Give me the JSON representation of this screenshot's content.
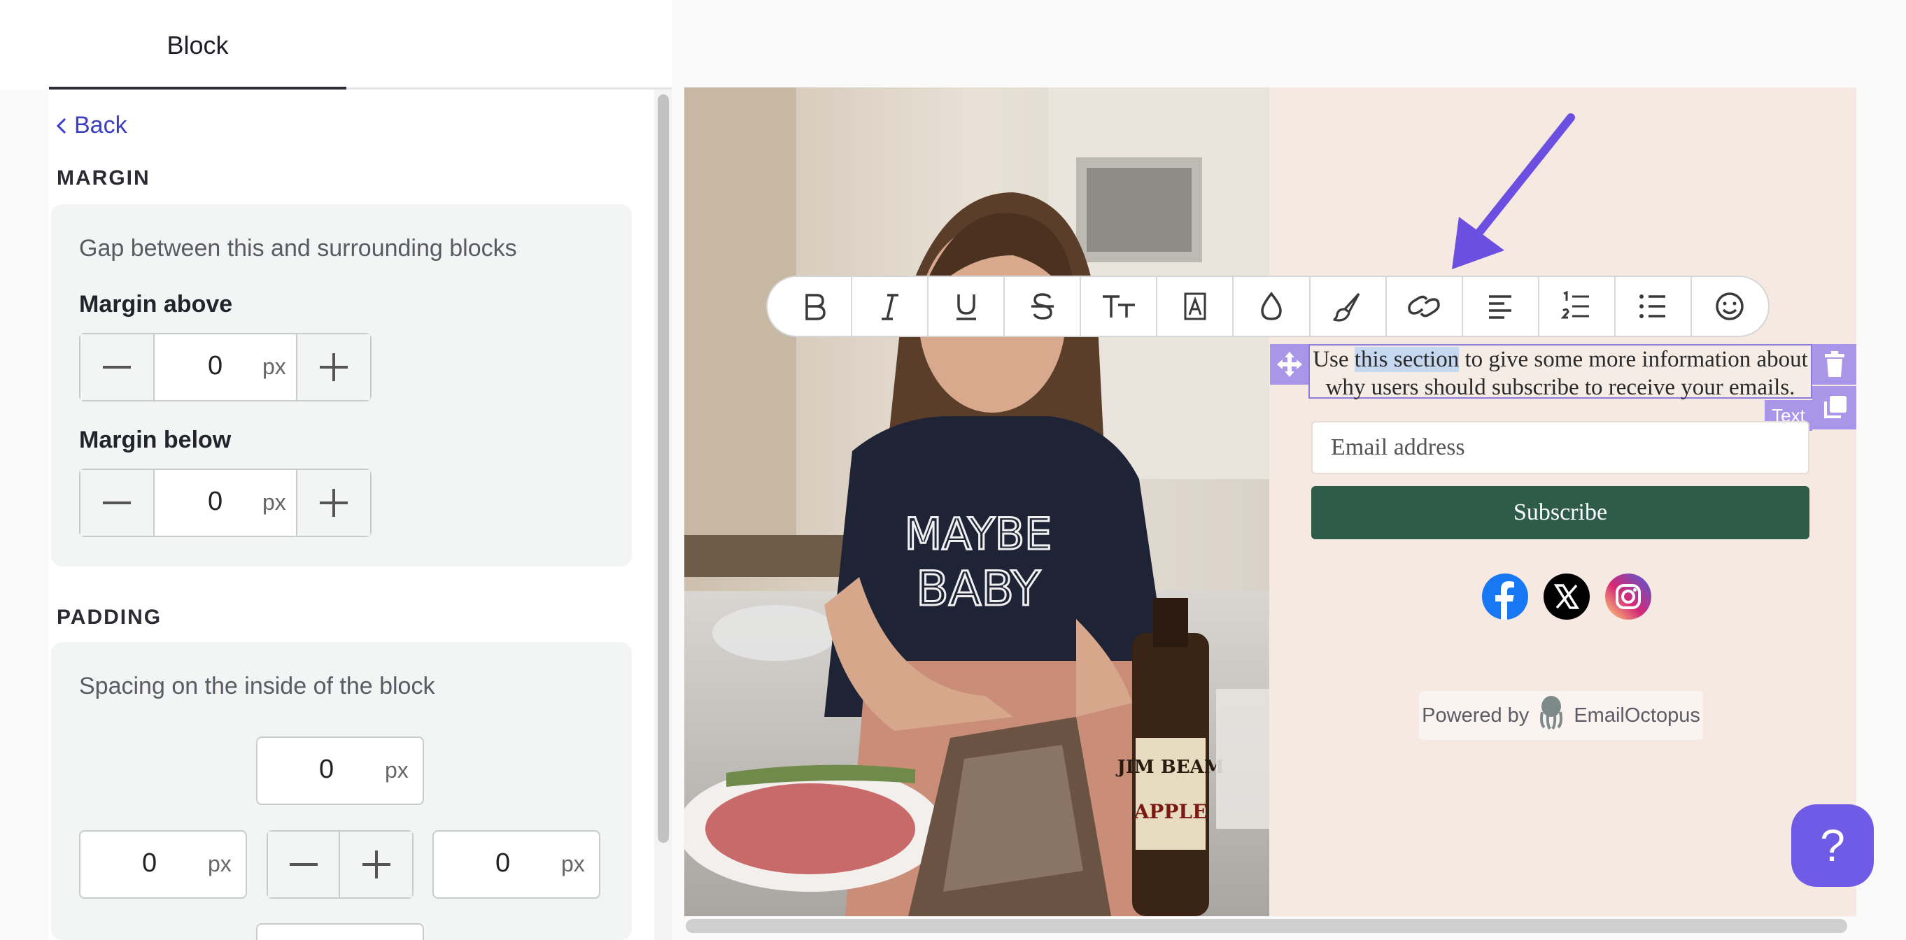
{
  "tabs": {
    "active": "Block"
  },
  "panel": {
    "back_label": "Back",
    "margin": {
      "heading": "MARGIN",
      "hint": "Gap between this and surrounding blocks",
      "above_label": "Margin above",
      "above_value": "0",
      "below_label": "Margin below",
      "below_value": "0",
      "unit": "px"
    },
    "padding": {
      "heading": "PADDING",
      "hint": "Spacing on the inside of the block",
      "top_value": "0",
      "left_value": "0",
      "right_value": "0",
      "unit": "px"
    }
  },
  "toolbar": {
    "buttons": [
      "bold-icon",
      "italic-icon",
      "underline-icon",
      "strikethrough-icon",
      "text-size-icon",
      "text-style-icon",
      "text-color-icon",
      "highlight-brush-icon",
      "link-icon",
      "align-left-icon",
      "ordered-list-icon",
      "bullet-list-icon",
      "emoji-icon"
    ]
  },
  "preview": {
    "text_before": "Use ",
    "text_selected": "this section",
    "text_after": " to give some more information about why users should subscribe to receive your emails.",
    "block_type": "Text",
    "email_placeholder": "Email address",
    "subscribe_label": "Subscribe",
    "social": [
      "facebook-icon",
      "x-icon",
      "instagram-icon"
    ],
    "powered_prefix": "Powered by",
    "powered_brand": "EmailOctopus",
    "sweater_text_1": "MAYBE",
    "sweater_text_2": "BABY",
    "bottle_text_1": "JIM BEAM",
    "bottle_text_2": "APPLE"
  },
  "help": {
    "label": "?"
  },
  "colors": {
    "accent": "#6f5be6",
    "link": "#3c3ec2",
    "subscribe_bg": "#2f5b4a",
    "preview_bg": "#f5e9e2",
    "selection_handle": "#a996e8"
  }
}
